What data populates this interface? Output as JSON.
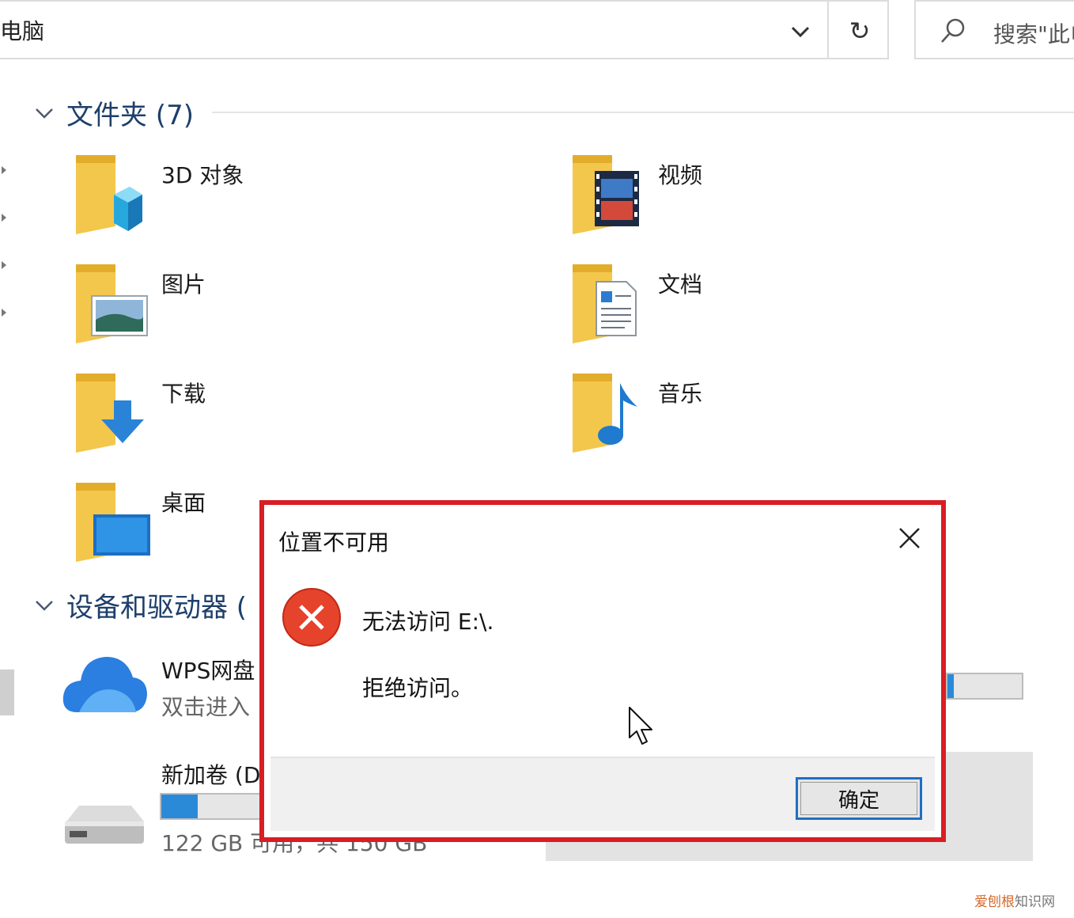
{
  "address_bar": {
    "path": "电脑",
    "refresh_glyph": "↻"
  },
  "search": {
    "placeholder": "搜索\"此电脑\""
  },
  "folders_group": {
    "title": "文件夹 (7)",
    "items": [
      {
        "label": "3D 对象",
        "icon": "3d-objects-folder-icon"
      },
      {
        "label": "视频",
        "icon": "videos-folder-icon"
      },
      {
        "label": "图片",
        "icon": "pictures-folder-icon"
      },
      {
        "label": "文档",
        "icon": "documents-folder-icon"
      },
      {
        "label": "下载",
        "icon": "downloads-folder-icon"
      },
      {
        "label": "音乐",
        "icon": "music-folder-icon"
      },
      {
        "label": "桌面",
        "icon": "desktop-folder-icon"
      }
    ]
  },
  "devices_group": {
    "title": "设备和驱动器 (",
    "items": [
      {
        "name": "WPS网盘",
        "sub": "双击进入",
        "icon": "wps-cloud-icon"
      },
      {
        "name": "新加卷 (D",
        "sub": "122 GB 可用，共 150 GB",
        "icon": "drive-icon",
        "used_fraction": 0.19
      }
    ]
  },
  "dialog": {
    "title": "位置不可用",
    "message": "无法访问 E:\\.",
    "detail": "拒绝访问。",
    "ok_label": "确定",
    "accent_color": "#d81e24"
  },
  "watermark": {
    "accent": "爱刨根",
    "rest": "知识网"
  }
}
